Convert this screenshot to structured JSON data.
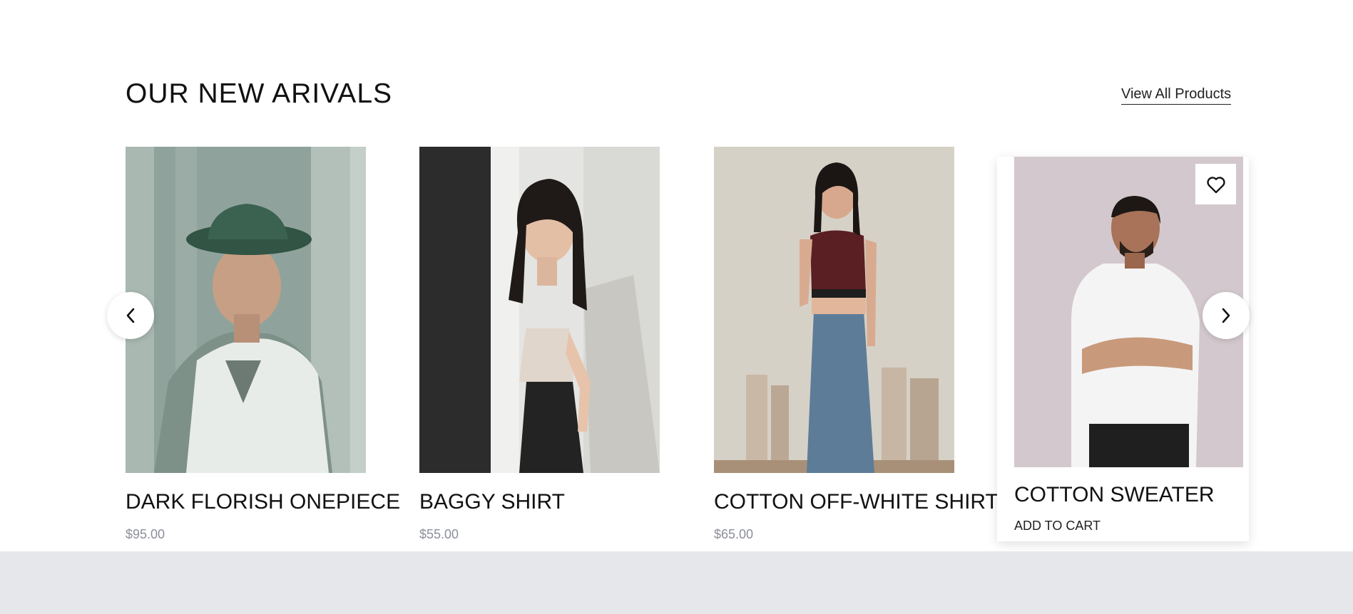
{
  "section": {
    "title": "OUR NEW ARIVALS",
    "view_all_label": "View All Products"
  },
  "products": [
    {
      "name": "DARK FLORISH ONEPIECE",
      "price": "$95.00",
      "photo": "man-in-bucket-hat-and-knit-vest"
    },
    {
      "name": "BAGGY SHIRT",
      "price": "$55.00",
      "photo": "woman-in-beige-crop-top-and-black-jeans"
    },
    {
      "name": "COTTON OFF-WHITE SHIRT",
      "price": "$65.00",
      "photo": "woman-in-maroon-sports-bra-and-denim"
    },
    {
      "name": "COTTON SWEATER",
      "add_to_cart_label": "ADD TO CART",
      "photo": "man-in-white-tshirt-arms-crossed"
    }
  ],
  "icons": {
    "prev": "chevron-left-icon",
    "next": "chevron-right-icon",
    "wishlist": "heart-icon"
  },
  "colors": {
    "price": "#8b8f99",
    "footer_band": "#e5e7eb",
    "text": "#111111"
  }
}
